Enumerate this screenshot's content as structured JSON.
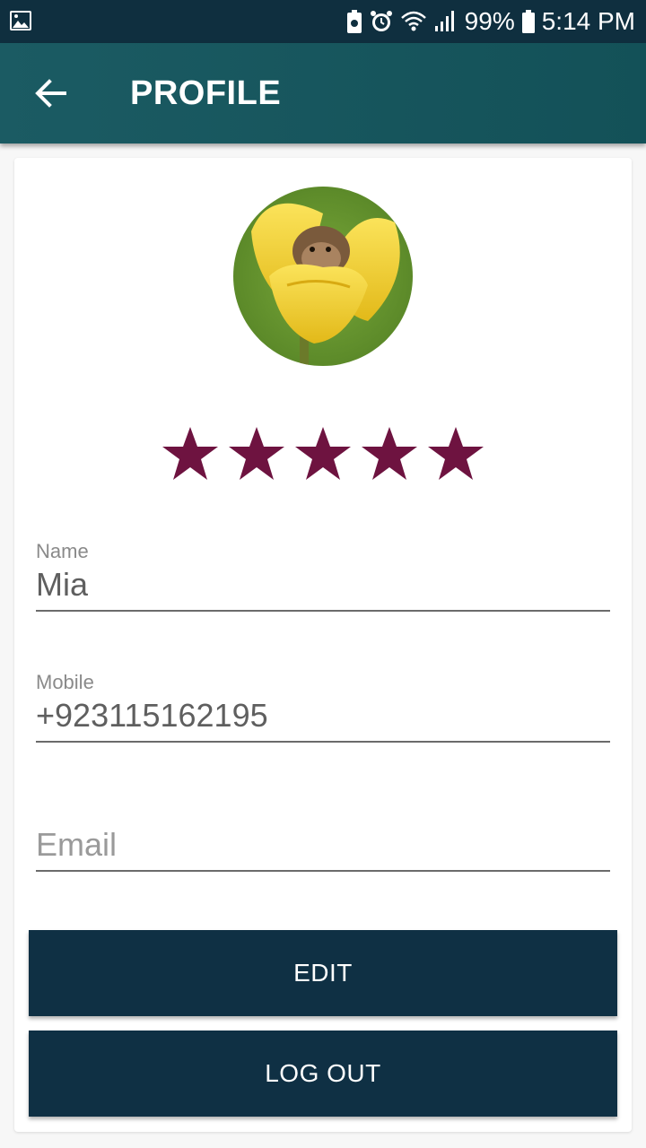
{
  "status_bar": {
    "battery": "99%",
    "time": "5:14 PM",
    "icons": [
      "gallery-icon",
      "battery-saver-icon",
      "alarm-icon",
      "wifi-icon",
      "signal-icon",
      "battery-icon"
    ]
  },
  "app_bar": {
    "title": "PROFILE",
    "back_icon": "arrow-left-icon",
    "background": "#135158"
  },
  "profile": {
    "avatar": "profile-photo",
    "rating": 5,
    "rating_max": 5,
    "star_color": "#6e1340"
  },
  "form": {
    "name_label": "Name",
    "name_value": "Mia",
    "mobile_label": "Mobile",
    "mobile_value": "+923115162195",
    "email_placeholder": "Email",
    "email_value": ""
  },
  "buttons": {
    "edit_label": "EDIT",
    "logout_label": "LOG OUT",
    "color": "#0f3044"
  }
}
